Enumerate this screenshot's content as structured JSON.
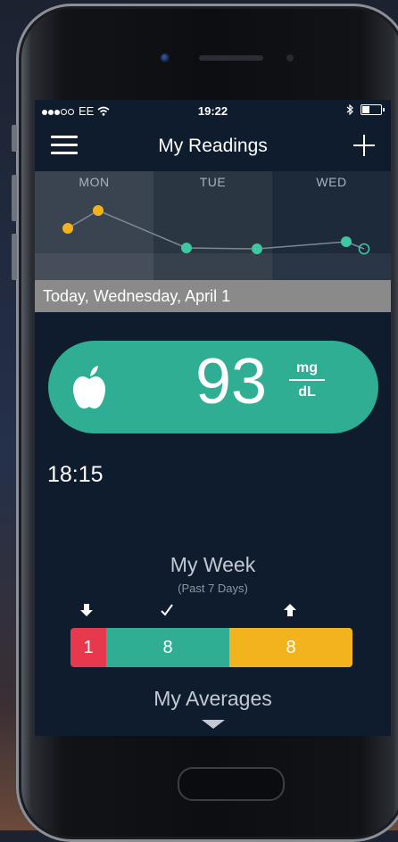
{
  "status_bar": {
    "carrier": "EE",
    "time": "19:22"
  },
  "nav": {
    "title": "My Readings"
  },
  "chart_data": {
    "type": "scatter",
    "categories": [
      "MON",
      "TUE",
      "WED"
    ],
    "series": [
      {
        "day": "MON",
        "color": "#f2b31d",
        "points": 2
      },
      {
        "day": "TUE",
        "color": "#3ec7a1",
        "points": 2
      },
      {
        "day": "WED",
        "color": "#3ec7a1",
        "points": 2,
        "last_point": "hollow"
      }
    ],
    "selected_day": "WED"
  },
  "date_banner": "Today, Wednesday, April 1",
  "reading": {
    "value": "93",
    "unit_top": "mg",
    "unit_bottom": "dL",
    "time": "18:15",
    "icon": "apple-icon",
    "color": "#2fae94"
  },
  "week": {
    "title": "My Week",
    "subtitle": "(Past 7 Days)",
    "segments": [
      {
        "label": "1",
        "value": 1,
        "color": "#e8384d",
        "icon": "arrow-down-icon"
      },
      {
        "label": "8",
        "value": 8,
        "color": "#2fae94",
        "icon": "check-icon"
      },
      {
        "label": "8",
        "value": 8,
        "color": "#f2b31d",
        "icon": "arrow-up-icon"
      }
    ]
  },
  "averages": {
    "title": "My Averages"
  }
}
